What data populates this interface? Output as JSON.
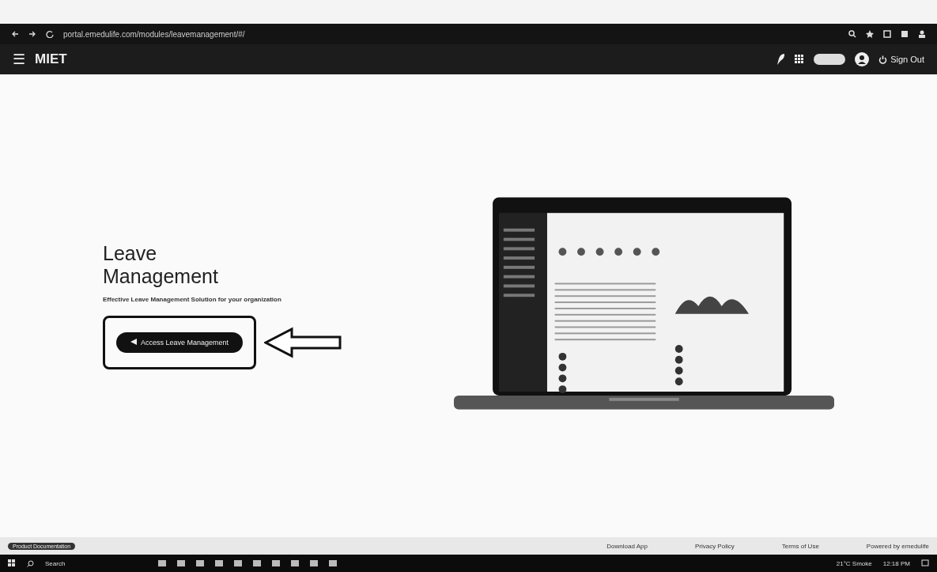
{
  "browser": {
    "url": "portal.emedulife.com/modules/leavemanagement/#/"
  },
  "header": {
    "menu": "☰",
    "brand": "MIET",
    "sign_out": "Sign Out"
  },
  "hero": {
    "title": "Leave Management",
    "subtitle": "Effective Leave Management Solution for your organization",
    "button": "Access Leave Management"
  },
  "footer": {
    "documentation": "Product Documentation",
    "download": "Download App",
    "links": [
      "Privacy Policy",
      "Terms of Use",
      "Powered by emedulife"
    ]
  },
  "taskbar": {
    "search": "Search",
    "weather": "21°C Smoke",
    "time": "12:18 PM"
  }
}
